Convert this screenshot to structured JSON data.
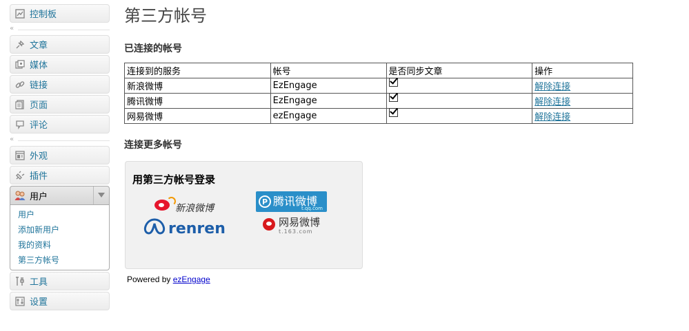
{
  "sidebar": {
    "dashboard": "控制板",
    "group1": [
      "文章",
      "媒体",
      "链接",
      "页面",
      "评论"
    ],
    "group2": [
      "外观",
      "插件"
    ],
    "users": {
      "label": "用户",
      "sub": [
        "用户",
        "添加新用户",
        "我的资料",
        "第三方帐号"
      ]
    },
    "group3": [
      "工具",
      "设置"
    ],
    "collapse_arrow": "«"
  },
  "page": {
    "title": "第三方帐号",
    "connected_heading": "已连接的帐号",
    "more_heading": "连接更多帐号"
  },
  "table": {
    "headers": [
      "连接到的服务",
      "帐号",
      "是否同步文章",
      "操作"
    ],
    "rows": [
      {
        "service": "新浪微博",
        "account": "EzEngage",
        "sync": true,
        "action": "解除连接"
      },
      {
        "service": "腾讯微博",
        "account": "EzEngage",
        "sync": true,
        "action": "解除连接"
      },
      {
        "service": "网易微博",
        "account": "ezEngage",
        "sync": true,
        "action": "解除连接"
      }
    ]
  },
  "widget": {
    "title": "用第三方帐号登录",
    "sina": "新浪微博",
    "qq": "腾讯微博",
    "qq_sub": "t.qq.com",
    "renren": "renren",
    "n163": "网易微博",
    "n163_sub": "t.163.com",
    "powered_prefix": "Powered by ",
    "powered_link": "ezEngage"
  }
}
